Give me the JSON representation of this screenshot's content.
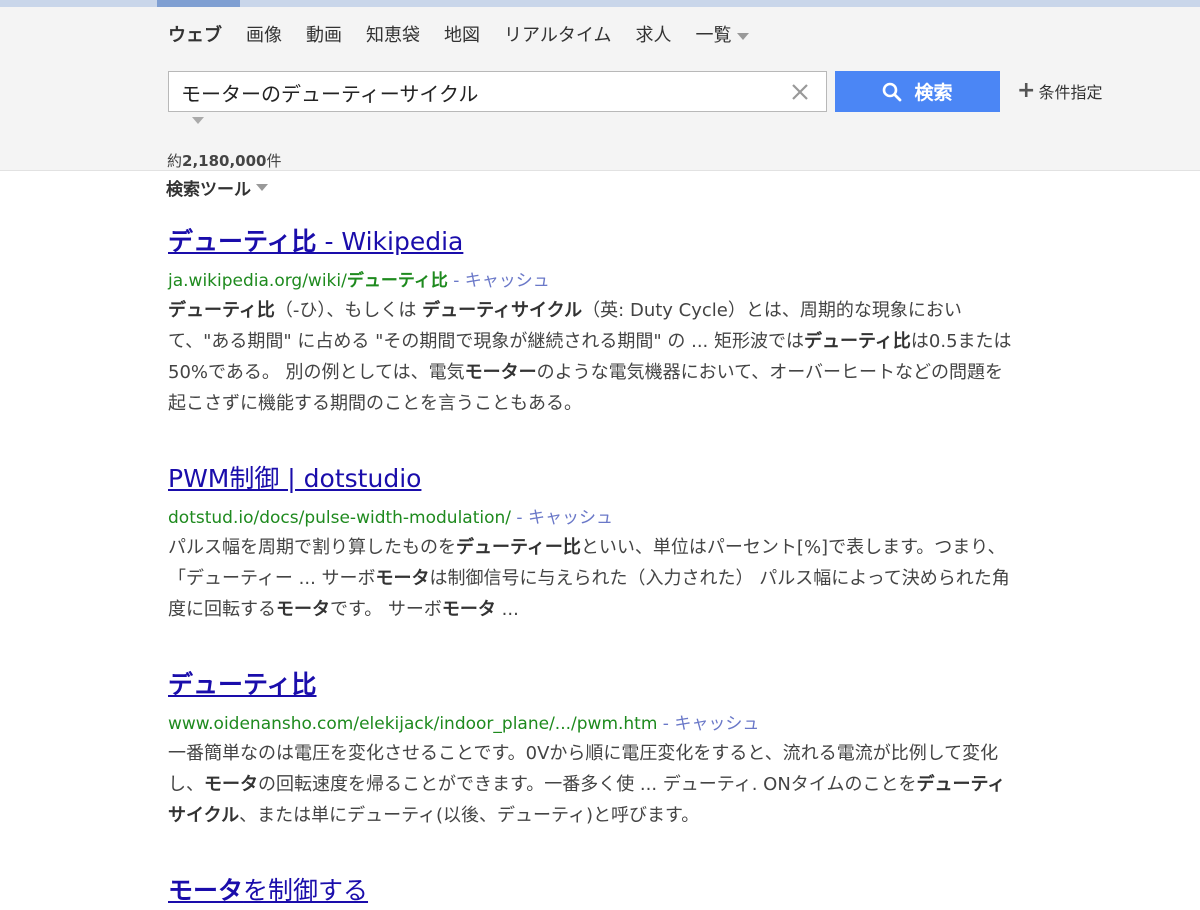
{
  "header": {
    "tabs": [
      {
        "label": "ウェブ"
      },
      {
        "label": "画像"
      },
      {
        "label": "動画"
      },
      {
        "label": "知恵袋"
      },
      {
        "label": "地図"
      },
      {
        "label": "リアルタイム"
      },
      {
        "label": "求人"
      },
      {
        "label": "一覧"
      }
    ]
  },
  "search": {
    "query": "モーターのデューティーサイクル",
    "button_label": "検索",
    "conditions_label": "条件指定"
  },
  "results_meta": {
    "prefix": "約",
    "count": "2,180,000",
    "suffix": "件",
    "tools_label": "検索ツール"
  },
  "results": [
    {
      "title": [
        {
          "t": "デューティ比",
          "b": true
        },
        {
          "t": " - Wikipedia",
          "b": false
        }
      ],
      "url": [
        {
          "t": "ja.wikipedia.org/wiki/",
          "b": false
        },
        {
          "t": "デューティ比",
          "b": true
        }
      ],
      "cache_label": "キャッシュ",
      "snippet": [
        {
          "t": "デューティ比",
          "b": true
        },
        {
          "t": "（-ひ）、もしくは ",
          "b": false
        },
        {
          "t": "デューティサイクル",
          "b": true
        },
        {
          "t": "（英: Duty Cycle）とは、周期的な現象において、\"ある期間\" に占める \"その期間で現象が継続される期間\" の ... 矩形波では",
          "b": false
        },
        {
          "t": "デューティ比",
          "b": true
        },
        {
          "t": "は0.5または50%である。 別の例としては、電気",
          "b": false
        },
        {
          "t": "モーター",
          "b": true
        },
        {
          "t": "のような電気機器において、オーバーヒートなどの問題を起こさずに機能する期間のことを言うこともある。",
          "b": false
        }
      ]
    },
    {
      "title": [
        {
          "t": "PWM制御 | dotstudio",
          "b": false
        }
      ],
      "url": [
        {
          "t": "dotstud.io/docs/pulse-width-modulation/",
          "b": false
        }
      ],
      "cache_label": "キャッシュ",
      "snippet": [
        {
          "t": "パルス幅を周期で割り算したものを",
          "b": false
        },
        {
          "t": "デューティー比",
          "b": true
        },
        {
          "t": "といい、単位はパーセント[%]で表します。つまり、「デューティー ... サーボ",
          "b": false
        },
        {
          "t": "モータ",
          "b": true
        },
        {
          "t": "は制御信号に与えられた（入力された） パルス幅によって決められた角度に回転する",
          "b": false
        },
        {
          "t": "モータ",
          "b": true
        },
        {
          "t": "です。 サーボ",
          "b": false
        },
        {
          "t": "モータ",
          "b": true
        },
        {
          "t": " ...",
          "b": false
        }
      ]
    },
    {
      "title": [
        {
          "t": "デューティ比",
          "b": true
        }
      ],
      "url": [
        {
          "t": "www.oidenansho.com/elekijack/indoor_plane/.../pwm.htm",
          "b": false
        }
      ],
      "cache_label": "キャッシュ",
      "snippet": [
        {
          "t": "一番簡単なのは電圧を変化させることです。0Vから順に電圧変化をすると、流れる電流が比例して変化し、",
          "b": false
        },
        {
          "t": "モータ",
          "b": true
        },
        {
          "t": "の回転速度を帰ることができます。一番多く使 ... デューティ. ONタイムのことを",
          "b": false
        },
        {
          "t": "デューティサイクル",
          "b": true
        },
        {
          "t": "、または単にデューティ(以後、デューティ)と呼びます。",
          "b": false
        }
      ]
    },
    {
      "title": [
        {
          "t": "モータ",
          "b": true
        },
        {
          "t": "を制御する",
          "b": false
        }
      ]
    }
  ],
  "colors": {
    "link": "#1a0dab",
    "url_green": "#1e8a1e",
    "cache": "#6a78c8",
    "search_button": "#4b86f5"
  }
}
